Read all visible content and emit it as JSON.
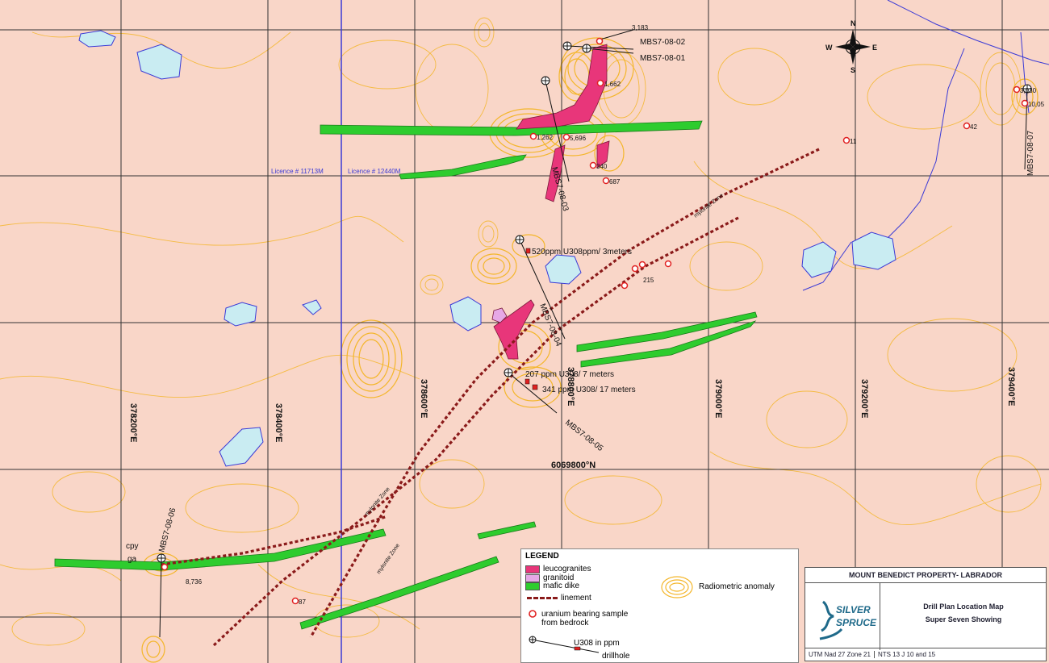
{
  "map": {
    "easting_labels": [
      "378200°E",
      "378400°E",
      "378600°E",
      "378800°E",
      "379000°E",
      "379200°E",
      "379400°E"
    ],
    "northing_label": "6069800°N",
    "licence_labels": [
      "Licence # 11713M",
      "Licence # 12440M"
    ],
    "drillholes": [
      "MBS7-08-02",
      "MBS7-08-01",
      "MBS7-08-03",
      "MBS7-08-04",
      "MBS7-08-05",
      "MBS7-08-06",
      "MBS7-08-07"
    ],
    "intercepts": [
      "520ppm U308ppm/ 3meters",
      "207 ppm U308/ 7 meters",
      "341 ppm U308/ 17 meters"
    ],
    "sample_values": [
      "3,183",
      "1,662",
      "1,262",
      "5,696",
      "340",
      "687",
      "215",
      "11",
      "42",
      "3,030",
      "10,05",
      "8,736",
      "87"
    ],
    "zone_labels": [
      "mylonite Zone",
      "mylonite Zone",
      "mylonite Zone"
    ],
    "mineral_labels": [
      "cpy",
      "ga"
    ],
    "compass": {
      "n": "N",
      "s": "S",
      "e": "E",
      "w": "W"
    },
    "colors": {
      "background": "#f9d6c8",
      "contour": "#f4b62a",
      "lake": "#c9ecf2",
      "dike": "#2ecc2e",
      "leucogranite": "#e8367a",
      "granitoid": "#e6a8e6",
      "lineament": "#8a1a1a",
      "licence_line": "#3a3ad6"
    }
  },
  "legend": {
    "title": "LEGEND",
    "leucogranites": "leucogranites",
    "granitoid": "granitoid",
    "mafic_dike": "mafic dike",
    "linement": "linement",
    "uranium_sample_1": "uranium bearing sample",
    "uranium_sample_2": "from bedrock",
    "u308": "U308 in ppm",
    "drillhole": "drillhole",
    "radiometric": "Radiometric anomaly"
  },
  "titleblock": {
    "heading": "MOUNT BENEDICT PROPERTY- LABRADOR",
    "line1": "Drill Plan Location Map",
    "line2": "Super Seven Showing",
    "logo1": "SILVER",
    "logo2": "SPRUCE",
    "footer_left": "UTM Nad 27 Zone 21",
    "footer_right": "NTS 13 J 10 and 15"
  }
}
